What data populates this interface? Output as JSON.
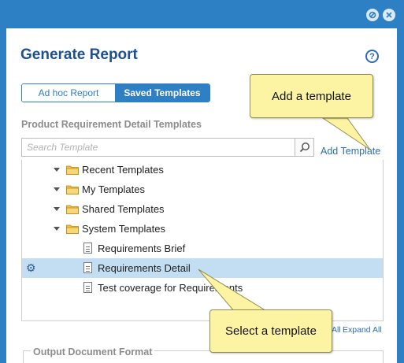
{
  "dialog": {
    "title": "Generate Report",
    "help_glyph": "?"
  },
  "tabs": {
    "adhoc_label": "Ad hoc Report",
    "saved_label": "Saved Templates",
    "active": "Saved Templates"
  },
  "section_title": "Product Requirement Detail Templates",
  "search": {
    "placeholder": "Search Template"
  },
  "add_template_label": "Add Template",
  "tree": {
    "folders": [
      {
        "label": "Recent Templates"
      },
      {
        "label": "My Templates"
      },
      {
        "label": "Shared Templates"
      },
      {
        "label": "System Templates"
      }
    ],
    "items": [
      {
        "label": "Requirements Brief"
      },
      {
        "label": "Requirements Detail",
        "selected": true
      },
      {
        "label": "Test coverage for Requirements"
      }
    ]
  },
  "collapse_all_partial": "All",
  "expand_all_label": "Expand All",
  "output_format_label": "Output Document Format",
  "callouts": {
    "add_template": "Add a template",
    "select_template": "Select a template"
  },
  "colors": {
    "accent": "#2e7fc4",
    "title": "#1d4f91",
    "selection": "#c3ddf2",
    "callout_fill": "#fdf4a3"
  }
}
